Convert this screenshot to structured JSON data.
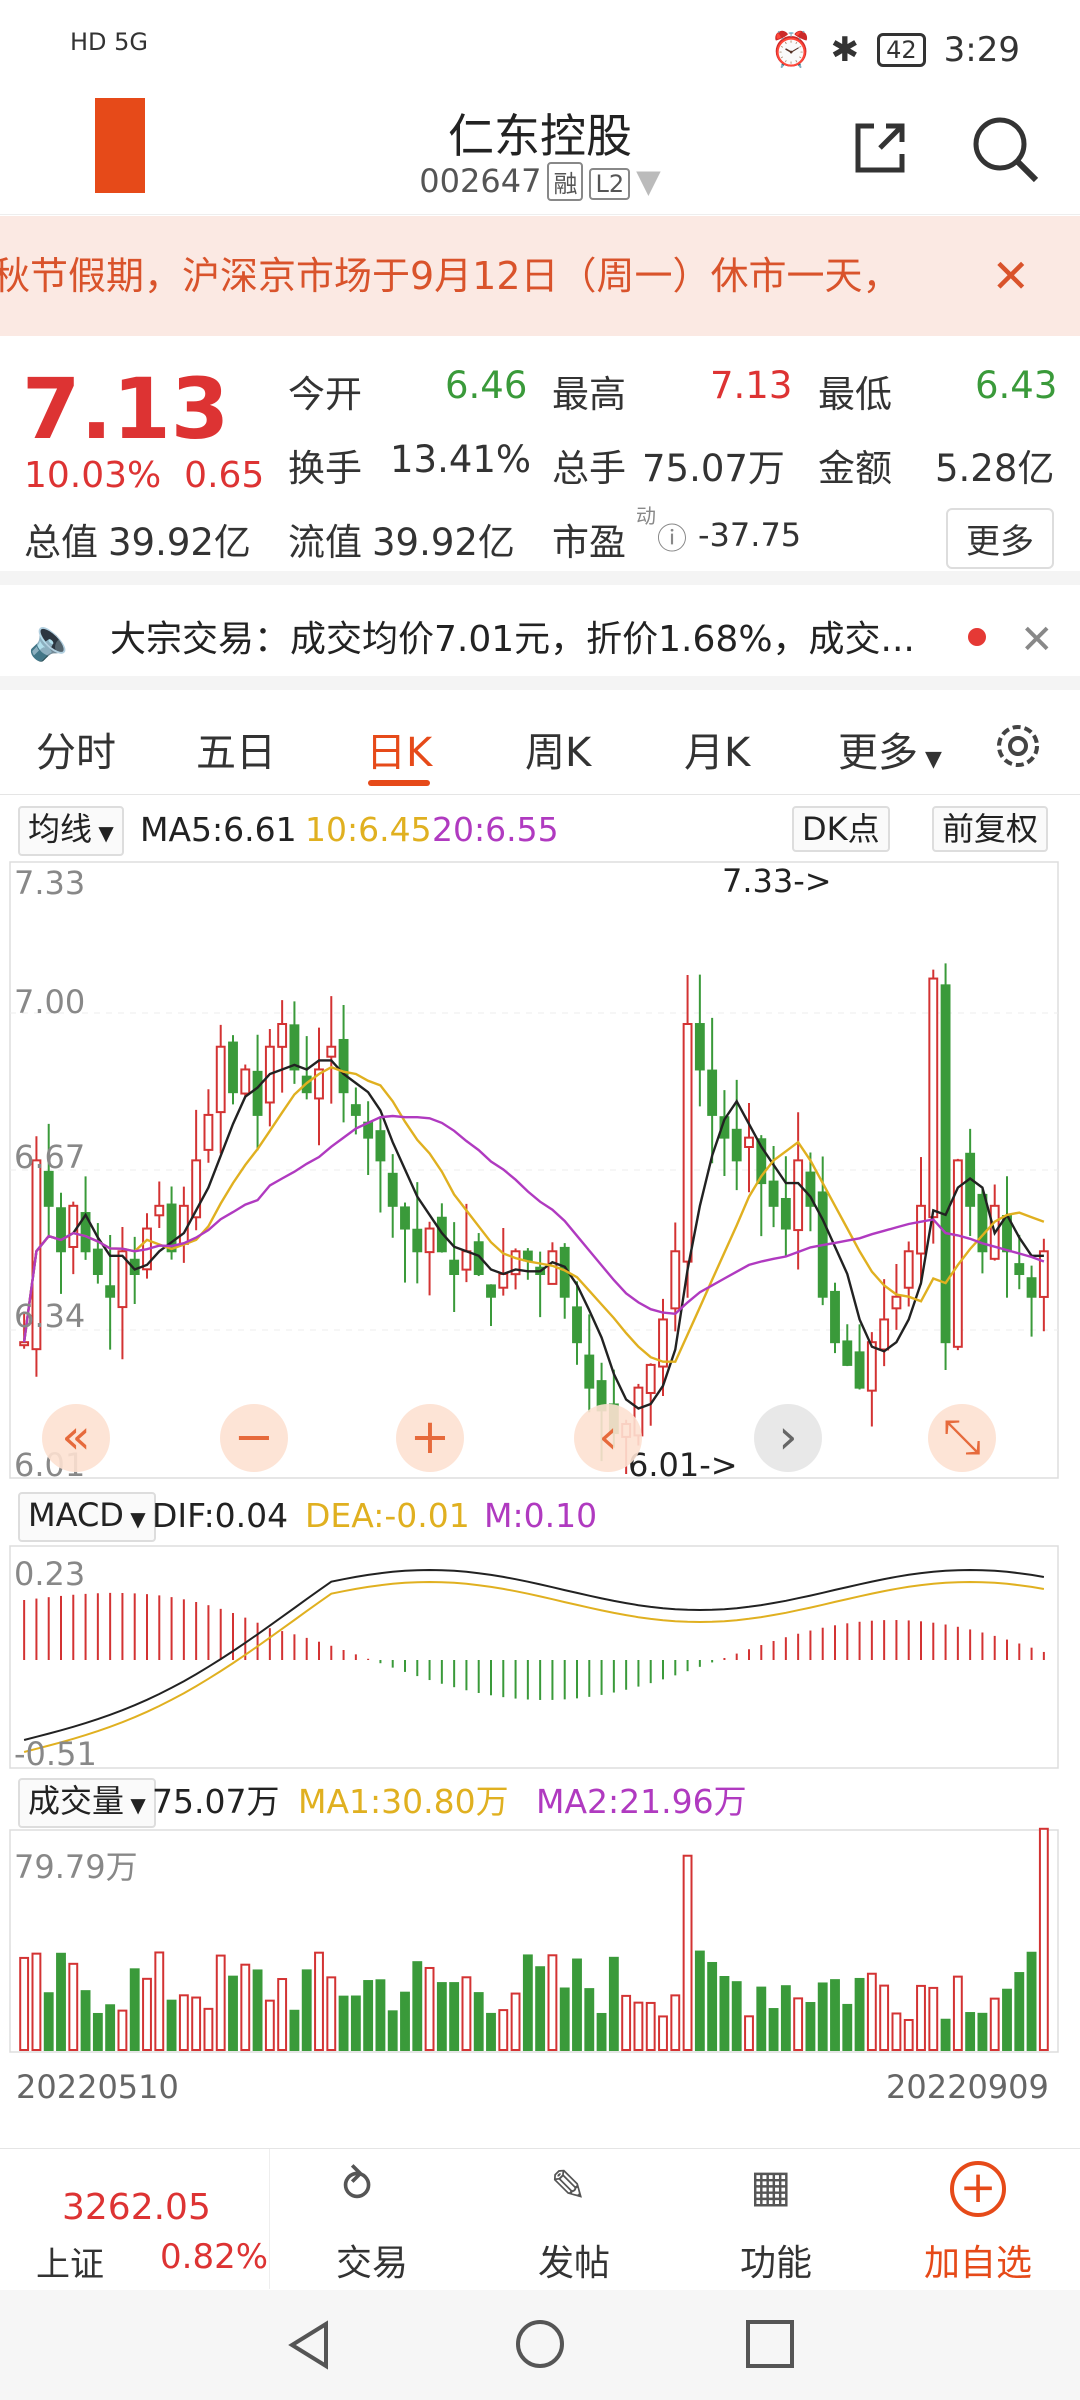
{
  "status": {
    "left": "HD 5G",
    "time": "3:29",
    "battery": "42"
  },
  "header": {
    "title": "仁东控股",
    "code": "002647",
    "tag1": "融",
    "tag2": "L2"
  },
  "notice": {
    "text": "秋节假期，沪深京市场于9月12日（周一）休市一天，",
    "close": "✕"
  },
  "quote": {
    "price": "7.13",
    "pct": "10.03%",
    "chg": "0.65",
    "open_label": "今开",
    "open": "6.46",
    "high_label": "最高",
    "high": "7.13",
    "low_label": "最低",
    "low": "6.43",
    "turnover_label": "换手",
    "turnover": "13.41%",
    "volume_label": "总手",
    "volume": "75.07万",
    "amount_label": "金额",
    "amount": "5.28亿",
    "mktcap_label": "总值",
    "mktcap": "39.92亿",
    "float_label": "流值",
    "float": "39.92亿",
    "pe_label": "市盈",
    "pe_sup": "动",
    "pe": "-37.75",
    "more": "更多"
  },
  "news": {
    "text": "大宗交易：成交均价7.01元，折价1.68%，成交..."
  },
  "tabs": [
    "分时",
    "五日",
    "日K",
    "周K",
    "月K",
    "更多"
  ],
  "kline_bar": {
    "ma_select": "均线",
    "ma5": "MA5:6.61",
    "ma10": "10:6.45",
    "ma20": "20:6.55",
    "dk": "DK点",
    "adjust": "前复权"
  },
  "price_axis": {
    "t1": "7.33",
    "t2": "7.00",
    "t3": "6.67",
    "t4": "6.34",
    "t5": "6.01",
    "hi_note": "7.33->",
    "lo_note": "6.01->"
  },
  "macd_bar": {
    "select": "MACD",
    "dif": "DIF:0.04",
    "dea": "DEA:-0.01",
    "m": "M:0.10",
    "top": "0.23",
    "bottom": "-0.51"
  },
  "vol_bar": {
    "select": "成交量",
    "vol": "75.07万",
    "ma1": "MA1:30.80万",
    "ma2": "MA2:21.96万",
    "top": "79.79万"
  },
  "dates": {
    "start": "20220510",
    "end": "20220909"
  },
  "bottom": {
    "index_value": "3262.05",
    "index_name": "上证",
    "index_pct": "0.82%",
    "trade": "交易",
    "post": "发帖",
    "func": "功能",
    "add": "加自选"
  },
  "colors": {
    "up": "#d33333",
    "down": "#3a9a3a",
    "accent": "#e64a19",
    "ma10": "#e0b020",
    "ma20": "#b03ac0"
  }
}
